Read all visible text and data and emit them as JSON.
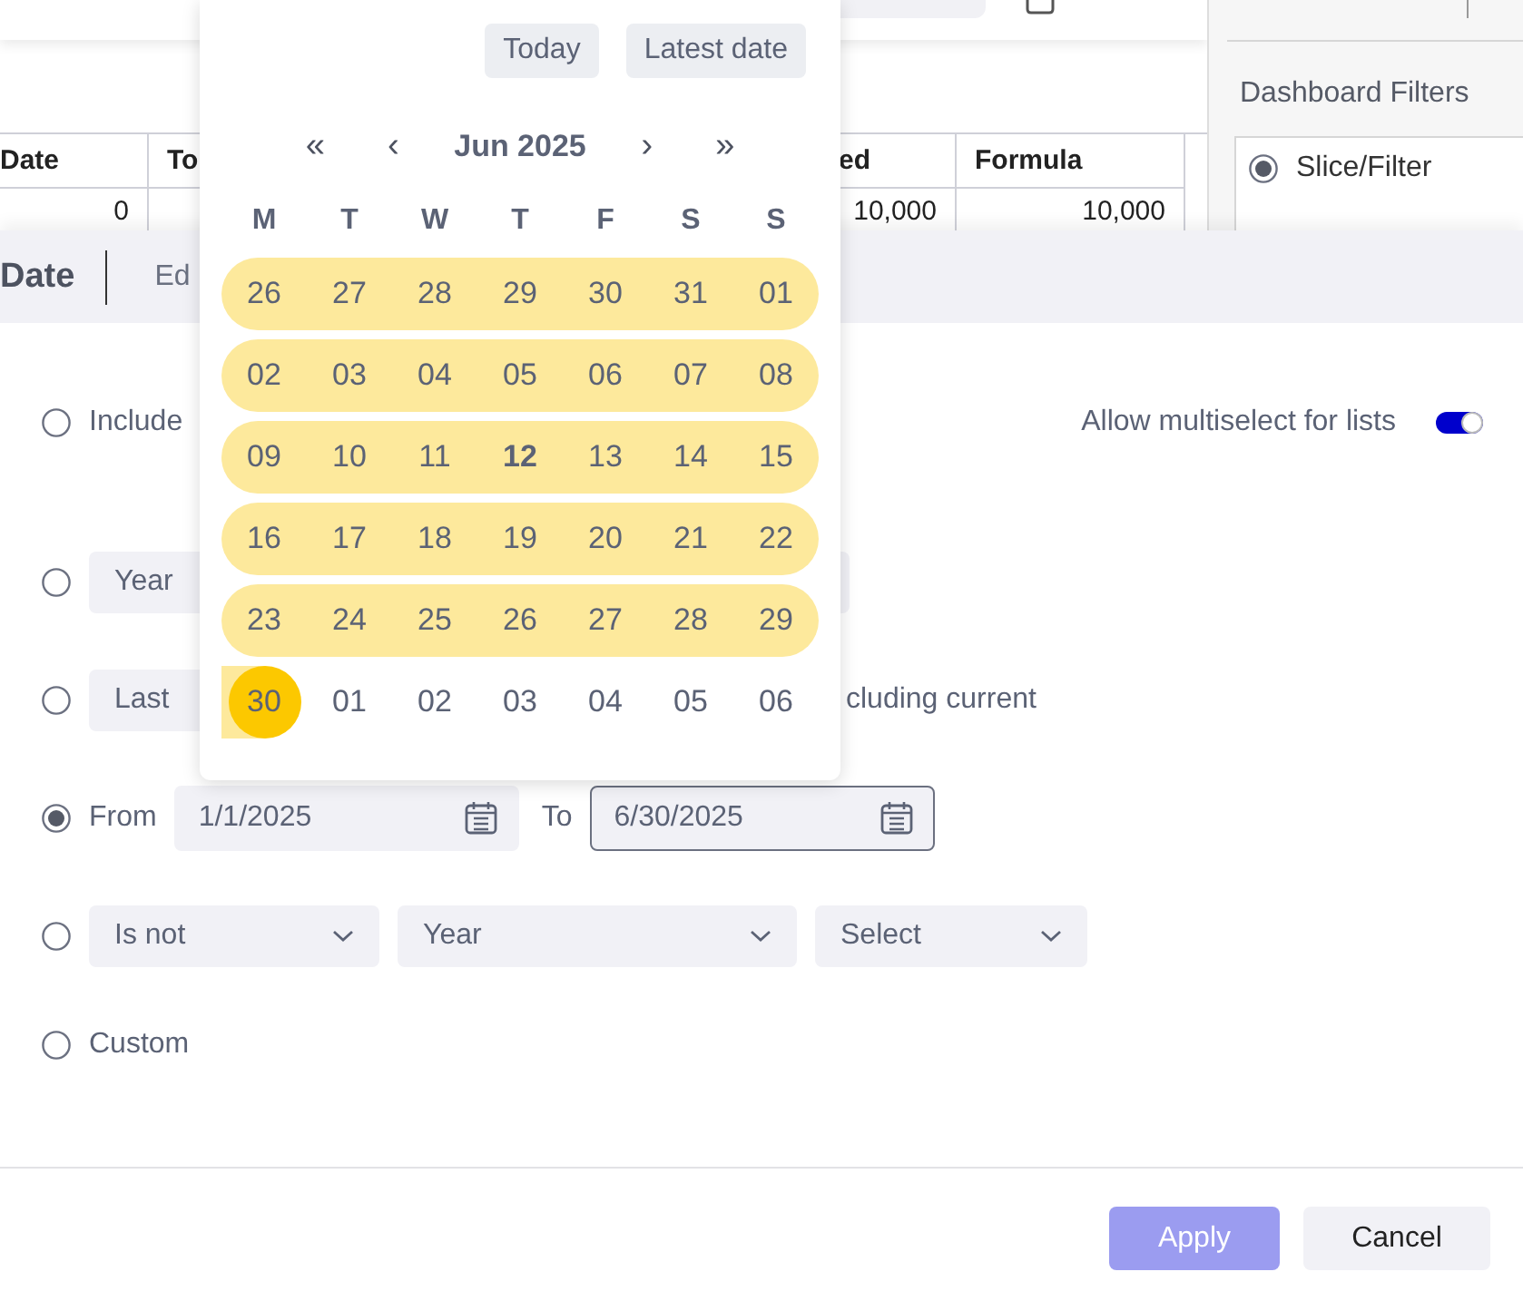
{
  "toolbar": {
    "checkbox": {
      "checked": false
    }
  },
  "table": {
    "columns": [
      "Date",
      "To",
      "ed",
      "Formula"
    ],
    "rows": [
      {
        "cells": [
          "0",
          null,
          "10,000",
          "10,000"
        ]
      }
    ]
  },
  "filters_panel": {
    "title": "Dashboard Filters",
    "options": [
      {
        "label": "Slice/Filter",
        "selected": true
      }
    ]
  },
  "dialog": {
    "tabs": [
      {
        "label": "Date",
        "selected": true
      },
      {
        "label": "Ed",
        "selected": false
      }
    ],
    "multiselect": {
      "label": "Allow multiselect for lists",
      "on": true
    },
    "options": [
      {
        "kind": "text",
        "selected": false,
        "label": "Include"
      },
      {
        "kind": "select",
        "selected": false,
        "select": "Year"
      },
      {
        "kind": "select_text",
        "selected": false,
        "select": "Last",
        "text": "cluding current"
      },
      {
        "kind": "range",
        "selected": true,
        "from_label": "From",
        "from": "1/1/2025",
        "to_label": "To",
        "to": "6/30/2025"
      },
      {
        "kind": "selects",
        "selected": false,
        "selects": [
          "Is not",
          "Year",
          "Select"
        ]
      },
      {
        "kind": "text",
        "selected": false,
        "label": "Custom"
      }
    ],
    "buttons": [
      {
        "label": "Apply",
        "kind": "primary"
      },
      {
        "label": "Cancel",
        "kind": "secondary"
      }
    ]
  },
  "calendar": {
    "shortcuts": [
      "Today",
      "Latest date"
    ],
    "nav": [
      "«",
      "‹",
      "›",
      "»"
    ],
    "month": "Jun 2025",
    "weekdays": [
      "M",
      "T",
      "W",
      "T",
      "F",
      "S",
      "S"
    ],
    "weeks": [
      [
        {
          "label": "26",
          "in_range": true,
          "selected": false,
          "today": false
        },
        {
          "label": "27",
          "in_range": true,
          "selected": false,
          "today": false
        },
        {
          "label": "28",
          "in_range": true,
          "selected": false,
          "today": false
        },
        {
          "label": "29",
          "in_range": true,
          "selected": false,
          "today": false
        },
        {
          "label": "30",
          "in_range": true,
          "selected": false,
          "today": false
        },
        {
          "label": "31",
          "in_range": true,
          "selected": false,
          "today": false
        },
        {
          "label": "01",
          "in_range": true,
          "selected": false,
          "today": false
        }
      ],
      [
        {
          "label": "02",
          "in_range": true,
          "selected": false,
          "today": false
        },
        {
          "label": "03",
          "in_range": true,
          "selected": false,
          "today": false
        },
        {
          "label": "04",
          "in_range": true,
          "selected": false,
          "today": false
        },
        {
          "label": "05",
          "in_range": true,
          "selected": false,
          "today": false
        },
        {
          "label": "06",
          "in_range": true,
          "selected": false,
          "today": false
        },
        {
          "label": "07",
          "in_range": true,
          "selected": false,
          "today": false
        },
        {
          "label": "08",
          "in_range": true,
          "selected": false,
          "today": false
        }
      ],
      [
        {
          "label": "09",
          "in_range": true,
          "selected": false,
          "today": false
        },
        {
          "label": "10",
          "in_range": true,
          "selected": false,
          "today": false
        },
        {
          "label": "11",
          "in_range": true,
          "selected": false,
          "today": false
        },
        {
          "label": "12",
          "in_range": true,
          "selected": false,
          "today": true
        },
        {
          "label": "13",
          "in_range": true,
          "selected": false,
          "today": false
        },
        {
          "label": "14",
          "in_range": true,
          "selected": false,
          "today": false
        },
        {
          "label": "15",
          "in_range": true,
          "selected": false,
          "today": false
        }
      ],
      [
        {
          "label": "16",
          "in_range": true,
          "selected": false,
          "today": false
        },
        {
          "label": "17",
          "in_range": true,
          "selected": false,
          "today": false
        },
        {
          "label": "18",
          "in_range": true,
          "selected": false,
          "today": false
        },
        {
          "label": "19",
          "in_range": true,
          "selected": false,
          "today": false
        },
        {
          "label": "20",
          "in_range": true,
          "selected": false,
          "today": false
        },
        {
          "label": "21",
          "in_range": true,
          "selected": false,
          "today": false
        },
        {
          "label": "22",
          "in_range": true,
          "selected": false,
          "today": false
        }
      ],
      [
        {
          "label": "23",
          "in_range": true,
          "selected": false,
          "today": false
        },
        {
          "label": "24",
          "in_range": true,
          "selected": false,
          "today": false
        },
        {
          "label": "25",
          "in_range": true,
          "selected": false,
          "today": false
        },
        {
          "label": "26",
          "in_range": true,
          "selected": false,
          "today": false
        },
        {
          "label": "27",
          "in_range": true,
          "selected": false,
          "today": false
        },
        {
          "label": "28",
          "in_range": true,
          "selected": false,
          "today": false
        },
        {
          "label": "29",
          "in_range": true,
          "selected": false,
          "today": false
        }
      ],
      [
        {
          "label": "30",
          "in_range": true,
          "selected": true,
          "today": false
        },
        {
          "label": "01",
          "in_range": false,
          "selected": false,
          "today": false
        },
        {
          "label": "02",
          "in_range": false,
          "selected": false,
          "today": false
        },
        {
          "label": "03",
          "in_range": false,
          "selected": false,
          "today": false
        },
        {
          "label": "04",
          "in_range": false,
          "selected": false,
          "today": false
        },
        {
          "label": "05",
          "in_range": false,
          "selected": false,
          "today": false
        },
        {
          "label": "06",
          "in_range": false,
          "selected": false,
          "today": false
        }
      ]
    ]
  }
}
